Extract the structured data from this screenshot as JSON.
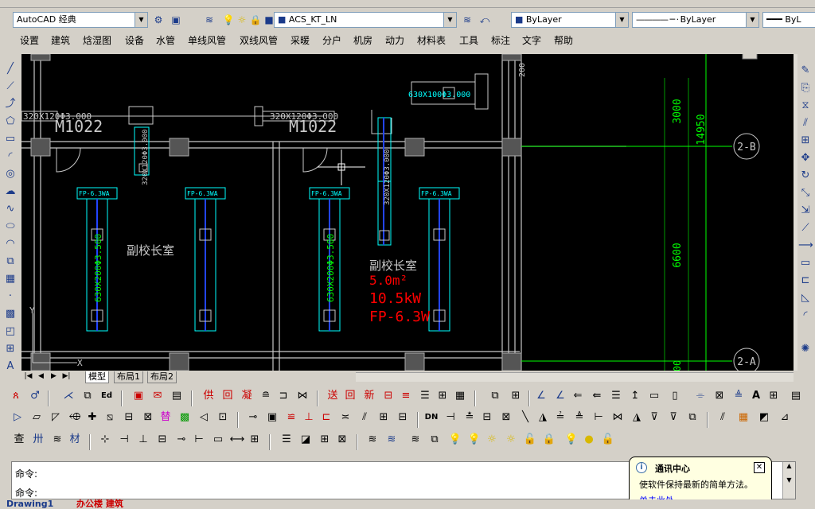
{
  "toolbar_top": {
    "workspace": "AutoCAD 经典",
    "layer": "ACS_KT_LN",
    "color": "ByLayer",
    "linetype": "ByLayer",
    "lineweight": "ByL"
  },
  "menu": [
    "设置",
    "建筑",
    "焓湿图",
    "设备",
    "水管",
    "单线风管",
    "双线风管",
    "采暖",
    "分户",
    "机房",
    "动力",
    "材料表",
    "工具",
    "标注",
    "文字",
    "帮助"
  ],
  "drawing": {
    "door1": "M1022",
    "door2": "M1022",
    "room1": "副校长室",
    "room2": "副校长室",
    "duct1": "320X120Φ3.000",
    "duct2": "320X120Φ3.000",
    "duct3": "630X100Φ3.000",
    "fcu": "FP-6.3WA",
    "vert1": "630X200Φ3.500",
    "vert2": "630X200Φ3.500",
    "vert3": "320X120Φ3.000",
    "vert4": "320X120Φ3.000",
    "red1": "5.0m²",
    "red2": "10.5kW",
    "red3": "FP-6.3W",
    "dim1": "3000",
    "dim2": "14950",
    "dim3": "6600",
    "dim4": "200",
    "axis1": "2-B",
    "axis2": "2-A",
    "ucs_y": "Y",
    "ucs_x": "X",
    "dim5": "00"
  },
  "tabs": [
    "模型",
    "布局1",
    "布局2"
  ],
  "command": {
    "line1": "命令:",
    "line2": "命令:"
  },
  "balloon": {
    "title": "通讯中心",
    "body": "使软件保持最新的简单方法。",
    "link": "单击此处。"
  },
  "status": {
    "item1": "Drawing1",
    "item2": "办公楼 建筑"
  },
  "colors": {
    "bg_drawing": "#000000",
    "cyan": "#00ffff",
    "green": "#00ff00",
    "red": "#ff0000",
    "blue": "#2244ff",
    "ui": "#d4d0c8"
  }
}
